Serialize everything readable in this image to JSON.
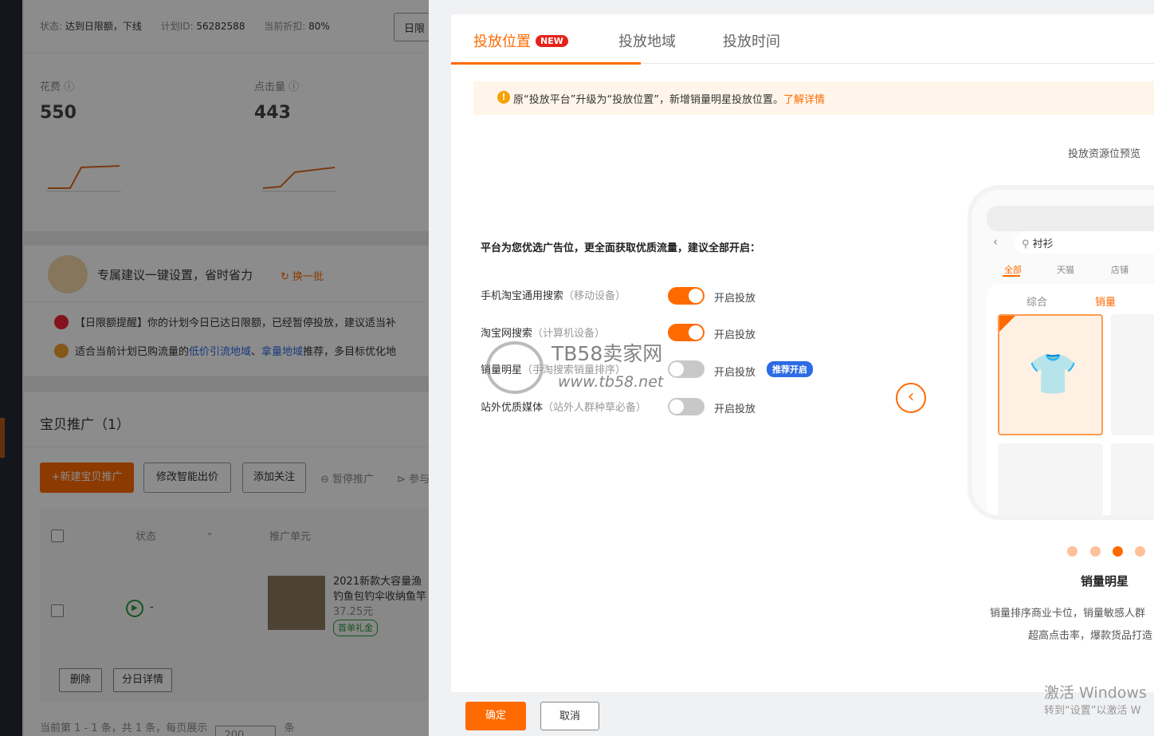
{
  "background": {
    "status": {
      "state_label": "状态:",
      "state_value": "达到日限额，下线",
      "plan_label": "计划ID:",
      "plan_value": "56282588",
      "discount_label": "当前折扣:",
      "discount_value": "80%",
      "daily_button": "日限"
    },
    "metrics": [
      {
        "label": "花费",
        "value": "550"
      },
      {
        "label": "点击量",
        "value": "443"
      }
    ],
    "advice": {
      "title": "专属建议一键设置，省时省力",
      "refresh": "换一批",
      "items": [
        {
          "bold": "【日限额提醒】",
          "text": "你的计划今日已达日限额，已经暂停投放，建议适当补"
        },
        {
          "pre": "适合当前计划已购流量的",
          "link1": "低价引流地域",
          "sep": "、",
          "link2": "拿量地域",
          "post": "推荐，多目标优化地"
        }
      ]
    },
    "promo": {
      "title": "宝贝推广（1）",
      "buttons": {
        "new": "+新建宝贝推广",
        "bid": "修改智能出价",
        "follow": "添加关注",
        "pause": "暂停推广",
        "join": "参与"
      },
      "table": {
        "col_status": "状态",
        "col_unit": "推广单元"
      },
      "item": {
        "title1": "2021新款大容量渔",
        "title2": "钓鱼包钓伞收纳鱼竿",
        "price": "37.25元",
        "tag": "首单礼金",
        "status": "-"
      },
      "actions": {
        "delete": "删除",
        "daily": "分日详情"
      },
      "pagination": {
        "text": "当前第 1 - 1 条，共 1 条，每页展示",
        "size": "200",
        "unit": "条"
      }
    }
  },
  "drawer": {
    "tabs": [
      {
        "label": "投放位置",
        "badge": "NEW",
        "active": true
      },
      {
        "label": "投放地域"
      },
      {
        "label": "投放时间"
      }
    ],
    "notice": {
      "text": "原“投放平台”升级为“投放位置”，新增销量明星投放位置。",
      "link": "了解详情"
    },
    "preview_title": "投放资源位预览",
    "heading": "平台为您优选广告位，更全面获取优质流量，建议全部开启：",
    "rows": [
      {
        "name": "手机淘宝通用搜索",
        "sub": "（移动设备）",
        "on": true,
        "state": "开启投放"
      },
      {
        "name": "淘宝网搜索",
        "sub": "（计算机设备）",
        "on": true,
        "state": "开启投放"
      },
      {
        "name": "销量明星",
        "sub": "（手淘搜索销量排序）",
        "on": false,
        "state": "开启投放",
        "badge": "推荐开启"
      },
      {
        "name": "站外优质媒体",
        "sub": "（站外人群种草必备）",
        "on": false,
        "state": "开启投放"
      }
    ],
    "phone": {
      "search": "衬衫",
      "filters": [
        "全部",
        "天猫",
        "店铺"
      ],
      "sorts": [
        "综合",
        "销量"
      ]
    },
    "carousel": {
      "title": "销量明星",
      "desc1": "销量排序商业卡位，销量敏感人群",
      "desc2": "超高点击率，爆款货品打造",
      "dots": 4,
      "active_dot": 3
    },
    "buttons": {
      "confirm": "确定",
      "cancel": "取消"
    }
  },
  "watermark": {
    "site_cn": "TB58卖家网",
    "site_url": "www.tb58.net"
  },
  "windows_activation": {
    "line1": "激活 Windows",
    "line2": "转到“设置”以激活 W"
  },
  "colors": {
    "accent": "#ff6a00",
    "badge_blue": "#2d6be4",
    "new_red": "#e6211a",
    "notice_bg": "#fff5ea"
  }
}
